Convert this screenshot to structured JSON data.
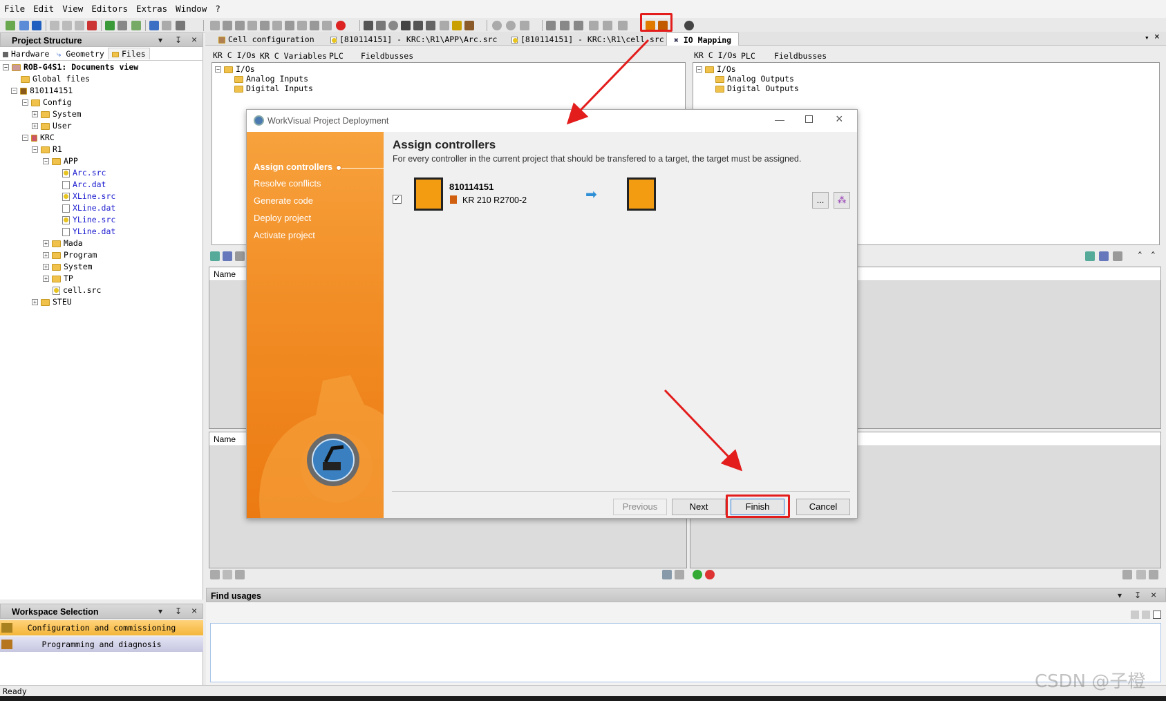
{
  "menu": [
    "File",
    "Edit",
    "View",
    "Editors",
    "Extras",
    "Window",
    "?"
  ],
  "project_panel": {
    "title": "Project Structure",
    "pin": "↧",
    "close": "×",
    "dropdown": "▾",
    "tabs": [
      "Hardware",
      "Geometry",
      "Files"
    ],
    "tree": [
      {
        "label": "ROB-G4S1: Documents view",
        "bold": true
      },
      {
        "label": "Global files"
      },
      {
        "label": "810114151"
      },
      {
        "label": "Config"
      },
      {
        "label": "System"
      },
      {
        "label": "User"
      },
      {
        "label": "KRC"
      },
      {
        "label": "R1"
      },
      {
        "label": "APP"
      },
      {
        "label": "Arc.src"
      },
      {
        "label": "Arc.dat"
      },
      {
        "label": "XLine.src"
      },
      {
        "label": "XLine.dat"
      },
      {
        "label": "YLine.src"
      },
      {
        "label": "YLine.dat"
      },
      {
        "label": "Mada"
      },
      {
        "label": "Program"
      },
      {
        "label": "System"
      },
      {
        "label": "TP"
      },
      {
        "label": "cell.src"
      },
      {
        "label": "STEU"
      }
    ]
  },
  "workspace_panel": {
    "title": "Workspace Selection",
    "items": [
      "Configuration and commissioning",
      "Programming and diagnosis"
    ]
  },
  "status_bar": "Ready",
  "editor_tabs": [
    "Cell configuration",
    "[810114151] - KRC:\\R1\\APP\\Arc.src",
    "[810114151] - KRC:\\R1\\cell.src",
    "IO Mapping"
  ],
  "io_left": {
    "subtabs": [
      "KR C I/Os",
      "KR C Variables",
      "PLC",
      "Fieldbusses"
    ],
    "tree": [
      "I/Os",
      "Analog Inputs",
      "Digital Inputs"
    ]
  },
  "io_right": {
    "subtabs": [
      "KR C I/Os",
      "PLC",
      "Fieldbusses"
    ],
    "tree": [
      "I/Os",
      "Analog Outputs",
      "Digital Outputs"
    ]
  },
  "grid_header": "Name",
  "find_usages": "Find usages",
  "dialog": {
    "title": "WorkVisual Project Deployment",
    "steps": [
      "Assign controllers",
      "Resolve conflicts",
      "Generate code",
      "Deploy project",
      "Activate project"
    ],
    "heading": "Assign controllers",
    "description": "For every controller in the current project that should be transfered to a target, the target must be assigned.",
    "controller": {
      "id": "810114151",
      "model": "KR 210 R2700-2",
      "checked": true
    },
    "browse_label": "...",
    "buttons": {
      "previous": "Previous",
      "next": "Next",
      "finish": "Finish",
      "cancel": "Cancel"
    }
  },
  "watermark": "CSDN @子橙",
  "colors": {
    "accent_orange": "#f28d25",
    "highlight_red": "#e31c1c",
    "link_blue": "#1a1ad0"
  }
}
